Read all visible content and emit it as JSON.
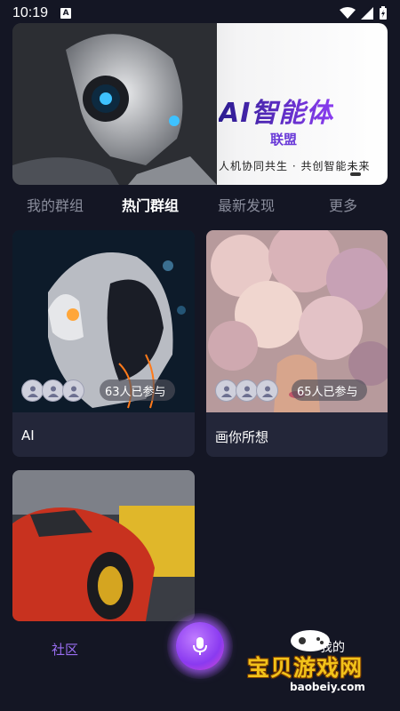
{
  "status": {
    "time": "10:19",
    "notif": "A"
  },
  "banner": {
    "title": "AI智能体",
    "subtitle": "联盟",
    "slogan": "人机协同共生 · 共创智能未来"
  },
  "tabs": [
    {
      "label": "我的群组",
      "active": false
    },
    {
      "label": "热门群组",
      "active": true
    },
    {
      "label": "最新发现",
      "active": false
    },
    {
      "label": "更多",
      "active": false
    }
  ],
  "groups": [
    {
      "title": "AI",
      "participants": "63人已参与"
    },
    {
      "title": "画你所想",
      "participants": "65人已参与"
    },
    {
      "title": "",
      "participants": ""
    }
  ],
  "nav": {
    "community": "社区",
    "mine": "我的"
  },
  "watermark": {
    "text": "宝贝游戏网",
    "url": "baobeiy.com"
  },
  "colors": {
    "bg": "#141624",
    "card": "#232639",
    "accent": "#9a6ef2",
    "mic": "#8a3af0"
  }
}
